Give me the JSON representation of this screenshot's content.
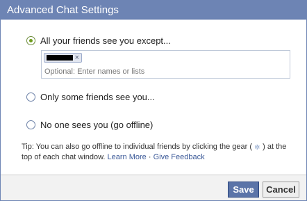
{
  "dialog": {
    "title": "Advanced Chat Settings"
  },
  "options": [
    {
      "label": "All your friends see you except...",
      "selected": true
    },
    {
      "label": "Only some friends see you...",
      "selected": false
    },
    {
      "label": "No one sees you (go offline)",
      "selected": false
    }
  ],
  "except_field": {
    "token_remove": "×",
    "placeholder": "Optional: Enter names or lists"
  },
  "tip": {
    "text_before": "Tip: You can also go offline to individual friends by clicking the gear (",
    "text_after": ") at the top of each chat window.",
    "learn_more": "Learn More",
    "separator": "·",
    "give_feedback": "Give Feedback"
  },
  "footer": {
    "save_label": "Save",
    "cancel_label": "Cancel"
  },
  "colors": {
    "title_bar": "#6d84b4",
    "link": "#3b5998",
    "save_button": "#5b74a8",
    "radio_selected": "#6d9c1c"
  }
}
